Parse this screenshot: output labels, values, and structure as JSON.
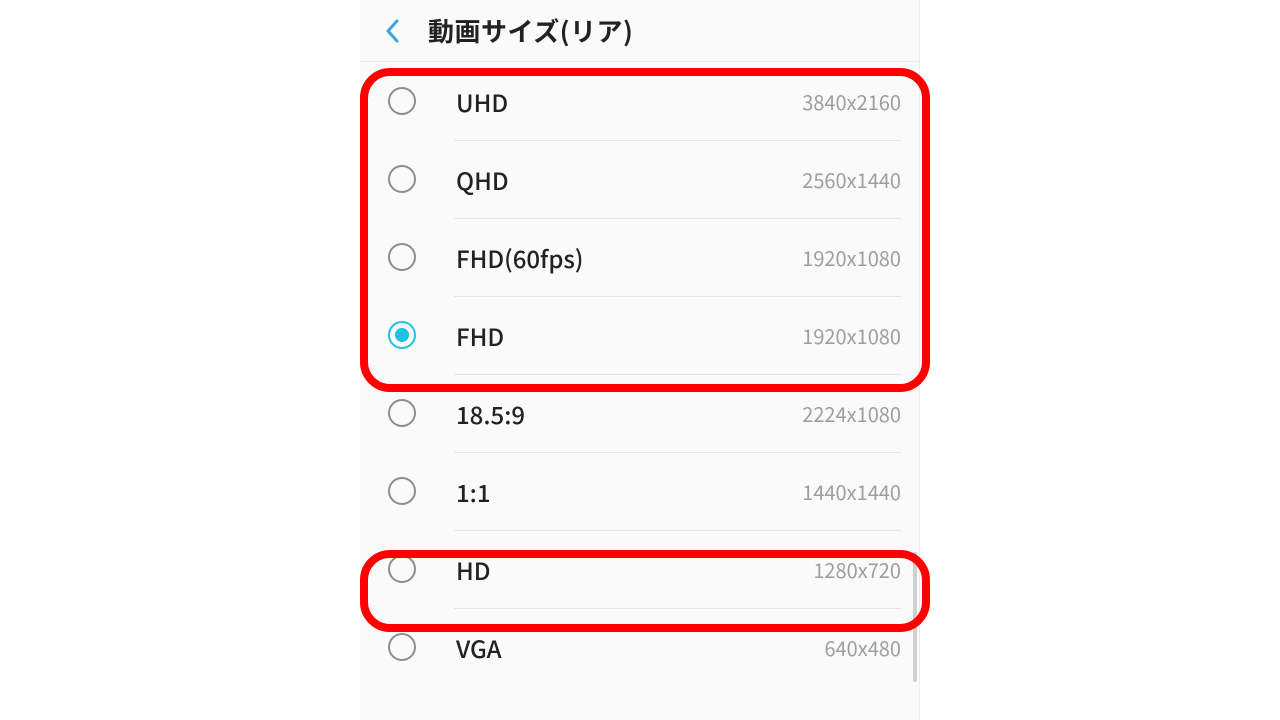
{
  "header": {
    "title": "動画サイズ(リア)",
    "back_icon": "back-chevron"
  },
  "options": [
    {
      "label": "UHD",
      "resolution": "3840x2160",
      "selected": false
    },
    {
      "label": "QHD",
      "resolution": "2560x1440",
      "selected": false
    },
    {
      "label": "FHD(60fps)",
      "resolution": "1920x1080",
      "selected": false
    },
    {
      "label": "FHD",
      "resolution": "1920x1080",
      "selected": true
    },
    {
      "label": "18.5:9",
      "resolution": "2224x1080",
      "selected": false
    },
    {
      "label": "1:1",
      "resolution": "1440x1440",
      "selected": false
    },
    {
      "label": "HD",
      "resolution": "1280x720",
      "selected": false
    },
    {
      "label": "VGA",
      "resolution": "640x480",
      "selected": false
    }
  ],
  "highlights": [
    {
      "covers": "options 0-3"
    },
    {
      "covers": "option 6"
    }
  ],
  "colors": {
    "accent": "#1fc2df",
    "highlight_border": "#ff0000",
    "text_primary": "#222222",
    "text_secondary": "#9e9e9e",
    "divider": "#e5e5e5",
    "background": "#fafafa"
  }
}
